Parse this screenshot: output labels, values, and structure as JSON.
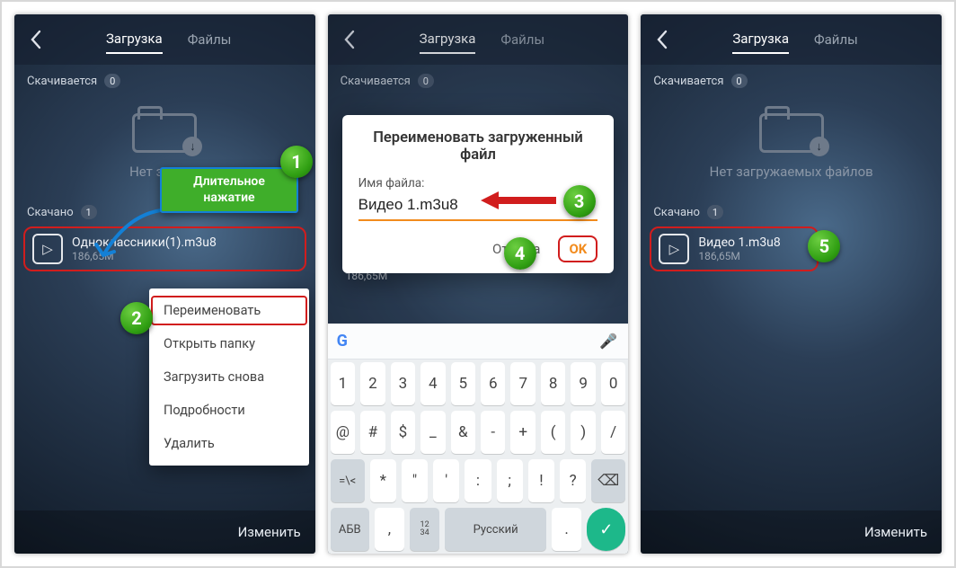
{
  "common": {
    "tab_download": "Загрузка",
    "tab_files": "Файлы",
    "downloading_label": "Скачивается",
    "downloading_count": "0",
    "empty_text": "Нет загружаемых файлов",
    "empty_text_clipped": "Нет загруж",
    "downloaded_label": "Скачано",
    "downloaded_count": "1",
    "edit_label": "Изменить"
  },
  "panel1": {
    "file_name": "Одноклассники(1).m3u8",
    "file_size": "186,65M",
    "tooltip_line1": "Длительное",
    "tooltip_line2": "нажатие",
    "menu": {
      "rename": "Переименовать",
      "open_folder": "Открыть папку",
      "reload": "Загрузить снова",
      "details": "Подробности",
      "delete": "Удалить"
    }
  },
  "panel2": {
    "dialog_title": "Переименовать загруженный файл",
    "field_label": "Имя файла:",
    "field_value": "Видео 1.m3u8",
    "cancel": "Отмена",
    "ok": "OK",
    "ghost_size": "186,65M",
    "keyboard": {
      "row1": [
        "1",
        "2",
        "3",
        "4",
        "5",
        "6",
        "7",
        "8",
        "9",
        "0"
      ],
      "row2": [
        "@",
        "#",
        "$",
        "_",
        "&",
        "-",
        "+",
        "(",
        ")",
        "/"
      ],
      "row3_lead": "=\\<",
      "row3": [
        "*",
        "\"",
        "'",
        ":",
        ";",
        "!",
        "?"
      ],
      "row3_back": "⌫",
      "row4_abc": "АБВ",
      "row4_comma": ",",
      "row4_numfrac": "12\n34",
      "row4_space": "Русский",
      "row4_dot": ".",
      "row4_enter": "✓",
      "mic_icon": "🎤"
    }
  },
  "panel3": {
    "file_name": "Видео 1.m3u8",
    "file_size": "186,65M"
  },
  "steps": {
    "s1": "1",
    "s2": "2",
    "s3": "3",
    "s4": "4",
    "s5": "5"
  }
}
